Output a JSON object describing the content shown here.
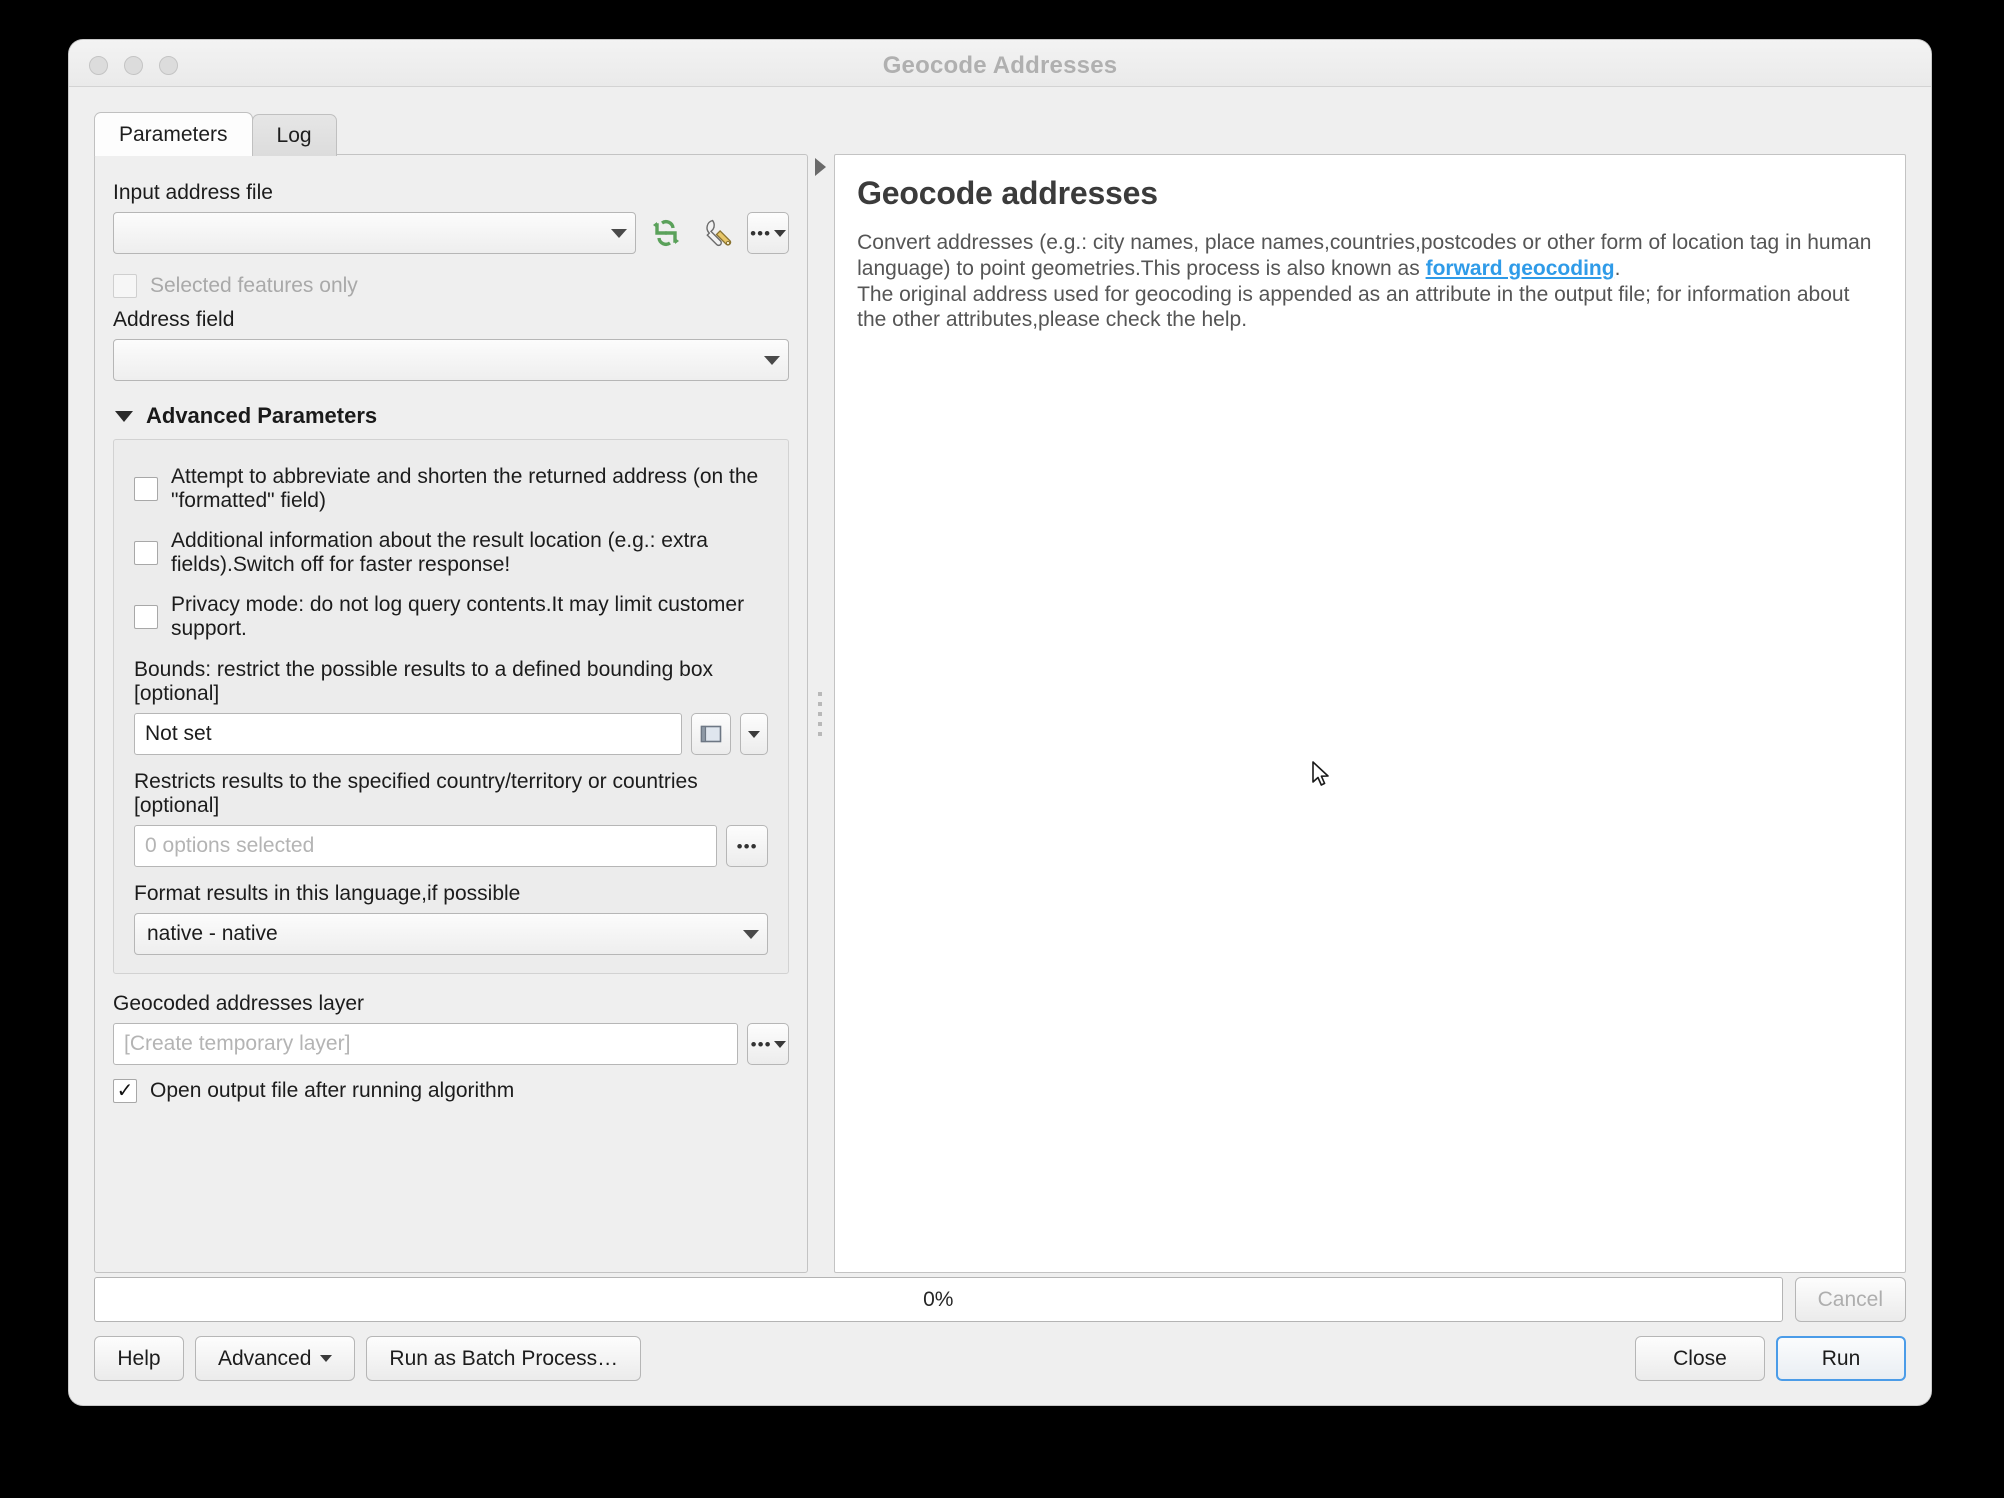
{
  "window": {
    "title": "Geocode Addresses",
    "traffic_lights": [
      "close",
      "minimize",
      "zoom"
    ]
  },
  "tabs": [
    {
      "id": "parameters",
      "label": "Parameters",
      "active": true
    },
    {
      "id": "log",
      "label": "Log",
      "active": false
    }
  ],
  "form": {
    "input_address_file": {
      "label": "Input address file",
      "value": "",
      "iterate_icon": "iterate-over-features-icon",
      "datadefined_icon": "wrench-icon",
      "browse_label": "…"
    },
    "selected_features_only": {
      "label": "Selected features only",
      "checked": false,
      "disabled": true
    },
    "address_field": {
      "label": "Address field",
      "value": ""
    },
    "advanced": {
      "header": "Advanced Parameters",
      "expanded": true,
      "checkboxes": [
        {
          "id": "abbreviate",
          "label": "Attempt to abbreviate and shorten the returned address (on the \"formatted\" field)",
          "checked": false
        },
        {
          "id": "extra_info",
          "label": "Additional information about the result location (e.g.: extra fields).Switch off for faster response!",
          "checked": false
        },
        {
          "id": "privacy",
          "label": "Privacy mode: do not log query contents.It may limit customer support.",
          "checked": false
        }
      ],
      "bounds": {
        "label": "Bounds: restrict the possible results to a defined bounding box [optional]",
        "value": "Not set",
        "extent_icon": "select-extent-on-canvas-icon",
        "dropdown_icon": "chevron-down-icon"
      },
      "countries": {
        "label": "Restricts results to the specified country/territory or countries [optional]",
        "placeholder": "0 options selected",
        "value": "",
        "browse_label": "…"
      },
      "language": {
        "label": "Format results in this language,if possible",
        "value": "native - native"
      }
    },
    "output": {
      "label": "Geocoded addresses layer",
      "placeholder": "[Create temporary layer]",
      "value": "",
      "browse_label": "…",
      "open_after_run": {
        "label": "Open output file after running algorithm",
        "checked": true,
        "check_glyph": "✓"
      }
    }
  },
  "help": {
    "title": "Geocode addresses",
    "paragraph_1_before_link": "Convert addresses (e.g.: city names, place names,countries,postcodes or other form of location tag in human language) to point geometries.This process is also known as ",
    "link_text": "forward geocoding",
    "paragraph_1_after_link": ".",
    "paragraph_2": "The original address used for geocoding is appended as an attribute in the output file; for information about the other attributes,please check the help.",
    "link_color": "#2f9be8"
  },
  "bottom": {
    "progress_text": "0%",
    "progress_percent": 0,
    "cancel_label": "Cancel",
    "cancel_disabled": true,
    "help_label": "Help",
    "advanced_label": "Advanced",
    "advanced_caret": "chevron-down-icon",
    "batch_label": "Run as Batch Process…",
    "close_label": "Close",
    "run_label": "Run",
    "run_focus_color": "#4b9ce8"
  },
  "colors": {
    "window_bg": "#efefef",
    "panel_bg": "#ffffff",
    "group_bg": "#ececec",
    "text": "#1c1c1c",
    "disabled_text": "#a9a9a9",
    "title_text": "#b0b0b0",
    "accent": "#4b9ce8",
    "icon_green": "#5aa15a"
  }
}
